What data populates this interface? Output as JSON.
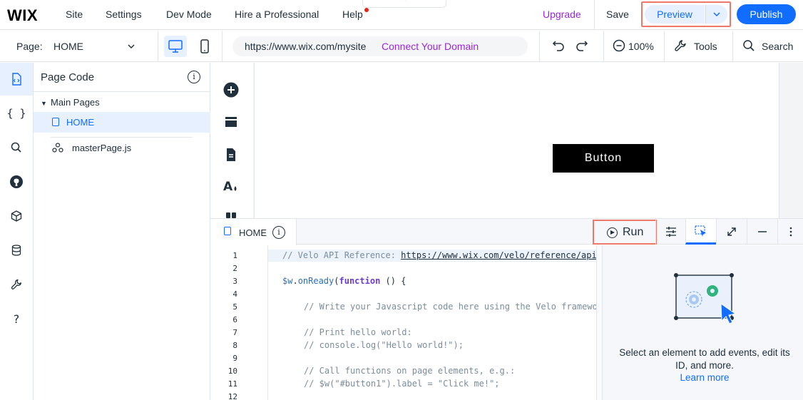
{
  "topbar": {
    "logo": "WIX",
    "menu": [
      "Site",
      "Settings",
      "Dev Mode",
      "Hire a Professional",
      "Help"
    ],
    "collapse_glyph": "⌃",
    "upgrade": "Upgrade",
    "save": "Save",
    "preview": "Preview",
    "publish": "Publish"
  },
  "subbar": {
    "page_label": "Page:",
    "page_value": "HOME",
    "url": "https://www.wix.com/mysite",
    "connect_domain": "Connect Your Domain",
    "zoom": "100%",
    "tools": "Tools",
    "search": "Search"
  },
  "rail": {
    "icons": [
      "page-code-icon",
      "code-braces-icon",
      "search-icon",
      "github-icon",
      "packages-icon",
      "database-icon",
      "developer-tools-icon",
      "help-icon"
    ]
  },
  "panel": {
    "title": "Page Code",
    "info": "i",
    "group": "Main Pages",
    "home": "HOME",
    "master": "masterPage.js"
  },
  "editor": {
    "tab_label": "HOME",
    "info": "i",
    "run": "Run",
    "line_numbers": [
      "1",
      "2",
      "3",
      "4",
      "5",
      "6",
      "7",
      "8",
      "9",
      "10",
      "11",
      "12"
    ],
    "lines": {
      "l1_comment": "// Velo API Reference: ",
      "l1_link": "https://www.wix.com/velo/reference/api-overview/introduction",
      "l3_var": "$w",
      "l3_dot": ".",
      "l3_fn": "onReady",
      "l3_paren": "(",
      "l3_kw": "function",
      "l3_rest": " () {",
      "l5": "// Write your Javascript code here using the Velo framework API",
      "l7": "// Print hello world:",
      "l8": "// console.log(\"Hello world!\");",
      "l10": "// Call functions on page elements, e.g.:",
      "l11": "// $w(\"#button1\").label = \"Click me!\";"
    },
    "props_message": "Select an element to add events, edit its ID, and more.",
    "props_link": "Learn more"
  },
  "canvas": {
    "button_label": "Button"
  },
  "colors": {
    "accent": "#116dff",
    "upgrade_purple": "#9a27d5",
    "highlight_outline": "#f0786b"
  }
}
